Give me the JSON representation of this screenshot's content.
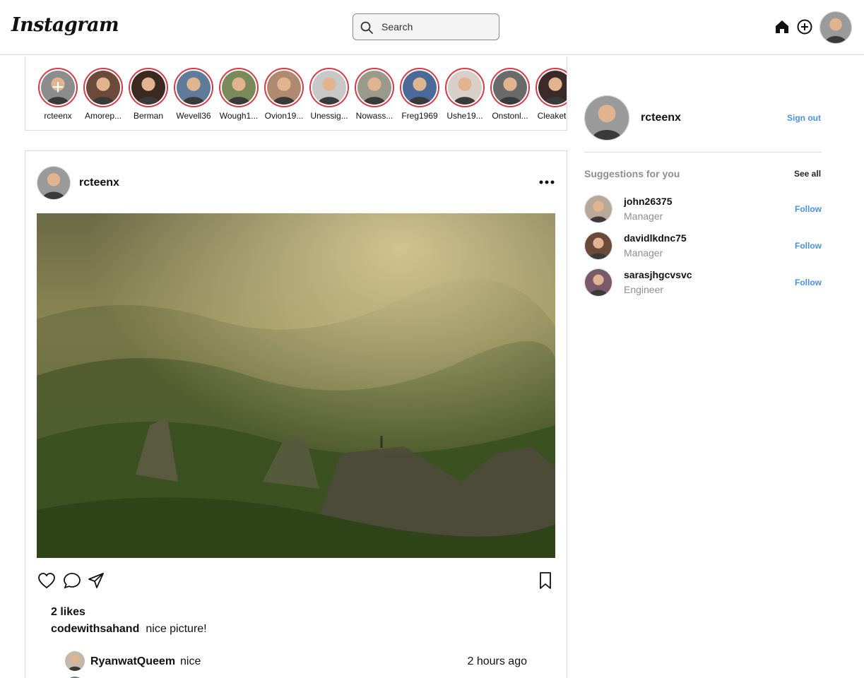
{
  "app": {
    "logo_text": "Instagram"
  },
  "header": {
    "search_placeholder": "Search",
    "icons": [
      "home-icon",
      "add-post-icon"
    ]
  },
  "stories": [
    {
      "name": "rcteenx",
      "is_self": true
    },
    {
      "name": "Amorep..."
    },
    {
      "name": "Berman"
    },
    {
      "name": "Wevell36"
    },
    {
      "name": "Wough1..."
    },
    {
      "name": "Ovion19..."
    },
    {
      "name": "Unessig..."
    },
    {
      "name": "Nowass..."
    },
    {
      "name": "Freg1969"
    },
    {
      "name": "Ushe19..."
    },
    {
      "name": "Onstonl..."
    },
    {
      "name": "Cleaket..."
    }
  ],
  "post": {
    "username": "rcteenx",
    "likes": "2 likes",
    "caption_user": "codewithsahand",
    "caption_text": "nice picture!",
    "comments": [
      {
        "user": "RyanwatQueem",
        "text": "nice",
        "time": "2 hours ago"
      }
    ]
  },
  "sidebar": {
    "username": "rcteenx",
    "sign_out": "Sign out",
    "suggestions_title": "Suggestions for you",
    "see_all": "See all",
    "suggestions": [
      {
        "username": "john26375",
        "role": "Manager",
        "action": "Follow"
      },
      {
        "username": "davidlkdnc75",
        "role": "Manager",
        "action": "Follow"
      },
      {
        "username": "sarasjhgcvsvc",
        "role": "Engineer",
        "action": "Follow"
      }
    ]
  },
  "colors": {
    "story_ring": "#d63a44",
    "link_blue": "#4a90e2",
    "muted_text": "#8e8e8e",
    "border": "#dbdbdb"
  }
}
